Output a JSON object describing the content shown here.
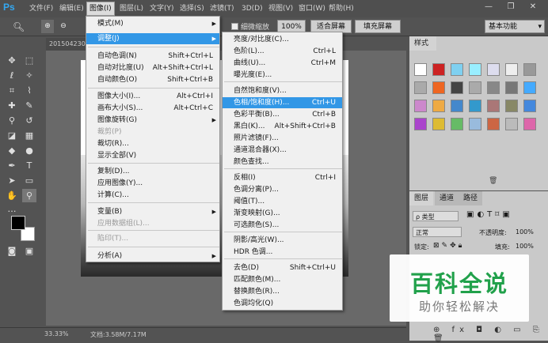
{
  "app": {
    "logo": "Ps",
    "window_controls": [
      "—",
      "❐",
      "✕"
    ]
  },
  "menubar": [
    "文件(F)",
    "编辑(E)",
    "图像(I)",
    "图层(L)",
    "文字(Y)",
    "选择(S)",
    "滤镜(T)",
    "3D(D)",
    "视图(V)",
    "窗口(W)",
    "帮助(H)"
  ],
  "options": {
    "zoom_value": "100%",
    "fine_zoom": "细微缩放",
    "fit_screen": "适合屏幕",
    "fill_screen": "填充屏幕",
    "workspace": "基本功能"
  },
  "document": {
    "tab": "2015042300",
    "zoom": "33.33%",
    "doc_info": "文档:3.58M/7.17M"
  },
  "image_menu": [
    {
      "label": "模式(M)",
      "shortcut": "",
      "submenu": true,
      "disabled": false
    },
    {
      "label": "调整(J)",
      "shortcut": "",
      "submenu": true,
      "disabled": false,
      "highlight": true
    },
    {
      "label": "自动色调(N)",
      "shortcut": "Shift+Ctrl+L",
      "disabled": false
    },
    {
      "label": "自动对比度(U)",
      "shortcut": "Alt+Shift+Ctrl+L",
      "disabled": false
    },
    {
      "label": "自动颜色(O)",
      "shortcut": "Shift+Ctrl+B",
      "disabled": false
    },
    {
      "label": "图像大小(I)...",
      "shortcut": "Alt+Ctrl+I",
      "disabled": false
    },
    {
      "label": "画布大小(S)...",
      "shortcut": "Alt+Ctrl+C",
      "disabled": false
    },
    {
      "label": "图像旋转(G)",
      "shortcut": "",
      "submenu": true,
      "disabled": false
    },
    {
      "label": "裁剪(P)",
      "shortcut": "",
      "disabled": true
    },
    {
      "label": "裁切(R)...",
      "shortcut": "",
      "disabled": false
    },
    {
      "label": "显示全部(V)",
      "shortcut": "",
      "disabled": false
    },
    {
      "label": "复制(D)...",
      "shortcut": "",
      "disabled": false
    },
    {
      "label": "应用图像(Y)...",
      "shortcut": "",
      "disabled": false
    },
    {
      "label": "计算(C)...",
      "shortcut": "",
      "disabled": false
    },
    {
      "label": "变量(B)",
      "shortcut": "",
      "submenu": true,
      "disabled": false
    },
    {
      "label": "应用数据组(L)...",
      "shortcut": "",
      "disabled": true
    },
    {
      "label": "陷印(T)...",
      "shortcut": "",
      "disabled": true
    },
    {
      "label": "分析(A)",
      "shortcut": "",
      "submenu": true,
      "disabled": false
    }
  ],
  "adjust_menu": [
    {
      "label": "亮度/对比度(C)...",
      "shortcut": ""
    },
    {
      "label": "色阶(L)...",
      "shortcut": "Ctrl+L"
    },
    {
      "label": "曲线(U)...",
      "shortcut": "Ctrl+M"
    },
    {
      "label": "曝光度(E)...",
      "shortcut": ""
    },
    {
      "label": "自然饱和度(V)...",
      "shortcut": ""
    },
    {
      "label": "色相/饱和度(H)...",
      "shortcut": "Ctrl+U",
      "highlight": true
    },
    {
      "label": "色彩平衡(B)...",
      "shortcut": "Ctrl+B"
    },
    {
      "label": "黑白(K)...",
      "shortcut": "Alt+Shift+Ctrl+B"
    },
    {
      "label": "照片滤镜(F)...",
      "shortcut": ""
    },
    {
      "label": "通道混合器(X)...",
      "shortcut": ""
    },
    {
      "label": "颜色查找...",
      "shortcut": ""
    },
    {
      "label": "反相(I)",
      "shortcut": "Ctrl+I"
    },
    {
      "label": "色调分离(P)...",
      "shortcut": ""
    },
    {
      "label": "阈值(T)...",
      "shortcut": ""
    },
    {
      "label": "渐变映射(G)...",
      "shortcut": ""
    },
    {
      "label": "可选颜色(S)...",
      "shortcut": ""
    },
    {
      "label": "阴影/高光(W)...",
      "shortcut": ""
    },
    {
      "label": "HDR 色调...",
      "shortcut": ""
    },
    {
      "label": "去色(D)",
      "shortcut": "Shift+Ctrl+U"
    },
    {
      "label": "匹配颜色(M)...",
      "shortcut": ""
    },
    {
      "label": "替换颜色(R)...",
      "shortcut": ""
    },
    {
      "label": "色调均化(Q)",
      "shortcut": ""
    }
  ],
  "styles_panel": {
    "tab": "样式"
  },
  "layers_panel": {
    "tabs": [
      "图层",
      "通道",
      "路径"
    ],
    "filter_kind": "ρ 类型",
    "blend_mode": "正常",
    "opacity_label": "不透明度:",
    "opacity_value": "100%",
    "lock_label": "锁定:",
    "fill_label": "填充:",
    "fill_value": "100%"
  },
  "watermark": {
    "title": "百科全说",
    "subtitle": "助你轻松解决"
  },
  "colors": {
    "highlight": "#3297e6",
    "watermark_green": "#21a14b",
    "ps_blue": "#33a8f2"
  }
}
